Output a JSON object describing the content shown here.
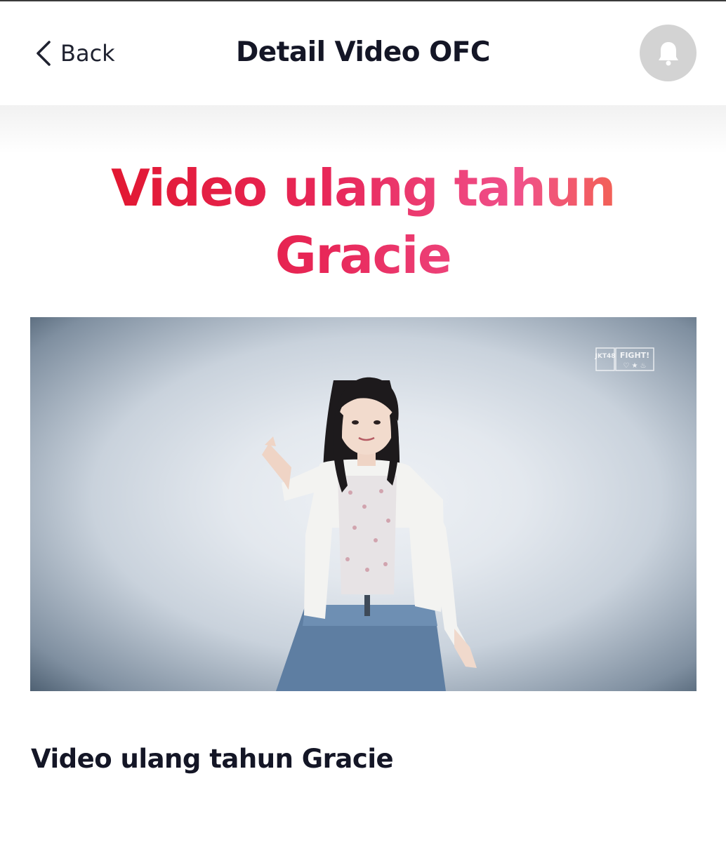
{
  "header": {
    "back_label": "Back",
    "title": "Detail Video OFC",
    "notification_icon": "bell-icon"
  },
  "hero": {
    "title": "Video ulang tahun Gracie",
    "gradient_colors": [
      "#e01428",
      "#e8285a",
      "#f0508a",
      "#f46a3a"
    ]
  },
  "video": {
    "thumbnail_subject": "person-posing-icon",
    "watermark_left": "JKT48",
    "watermark_right": "FIGHT!"
  },
  "caption": {
    "title": "Video ulang tahun Gracie"
  },
  "colors": {
    "text": "#141626",
    "notification_bg": "#d3d3d3"
  }
}
